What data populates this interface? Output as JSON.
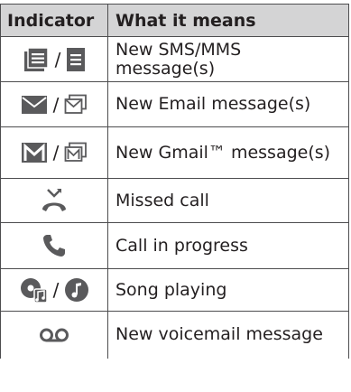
{
  "table": {
    "headers": [
      "Indicator",
      "What it means"
    ],
    "separator": "/",
    "rows": [
      {
        "icons": [
          "sms-icon",
          "sms-small-icon"
        ],
        "meaning": "New SMS/MMS message(s)"
      },
      {
        "icons": [
          "email-icon",
          "email-small-icon"
        ],
        "meaning": "New Email message(s)"
      },
      {
        "icons": [
          "gmail-icon",
          "gmail-small-icon"
        ],
        "meaning": "New Gmail™ message(s)"
      },
      {
        "icons": [
          "missed-call-icon"
        ],
        "meaning": "Missed call"
      },
      {
        "icons": [
          "call-in-progress-icon"
        ],
        "meaning": "Call in progress"
      },
      {
        "icons": [
          "song-playing-icon",
          "music-note-icon"
        ],
        "meaning": "Song playing"
      },
      {
        "icons": [
          "voicemail-icon"
        ],
        "meaning": "New voicemail message"
      }
    ]
  },
  "colors": {
    "header_background": "#d4d4d5",
    "icon_color": "#5a5a5c",
    "border_color": "#4d4d4f"
  }
}
